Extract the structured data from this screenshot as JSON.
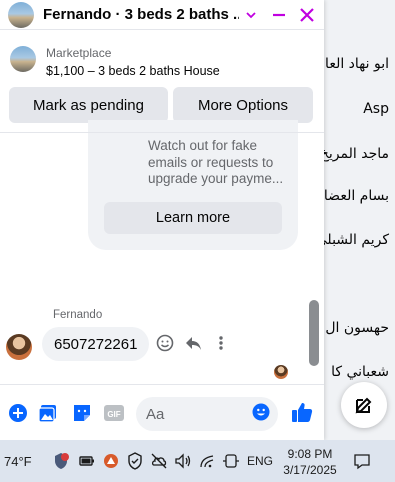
{
  "background_list": {
    "names": [
      "ابو نهاد العا",
      "Asp",
      "ماجد المريخ",
      "بسام العضا",
      "كريم الشبلي",
      "حهسون ال",
      "شعباني كا"
    ]
  },
  "chat": {
    "title": "Fernando · 3 beds 2 baths ...",
    "listing": {
      "source": "Marketplace",
      "title": "$1,100 – 3 beds 2 baths House"
    },
    "buttons": {
      "mark_pending": "Mark as pending",
      "more_options": "More Options"
    },
    "notice": {
      "text": "Watch out for fake emails or requests to upgrade your payme...",
      "learn_more": "Learn more"
    },
    "message": {
      "sender": "Fernando",
      "text": "6507272261"
    },
    "composer": {
      "placeholder": "Aa"
    }
  },
  "taskbar": {
    "weather": "74°F",
    "language": "ENG",
    "time": "9:08 PM",
    "date": "3/17/2025"
  },
  "colors": {
    "accent": "#0866ff",
    "magenta": "#c000e0",
    "bubble": "#f0f2f5"
  }
}
